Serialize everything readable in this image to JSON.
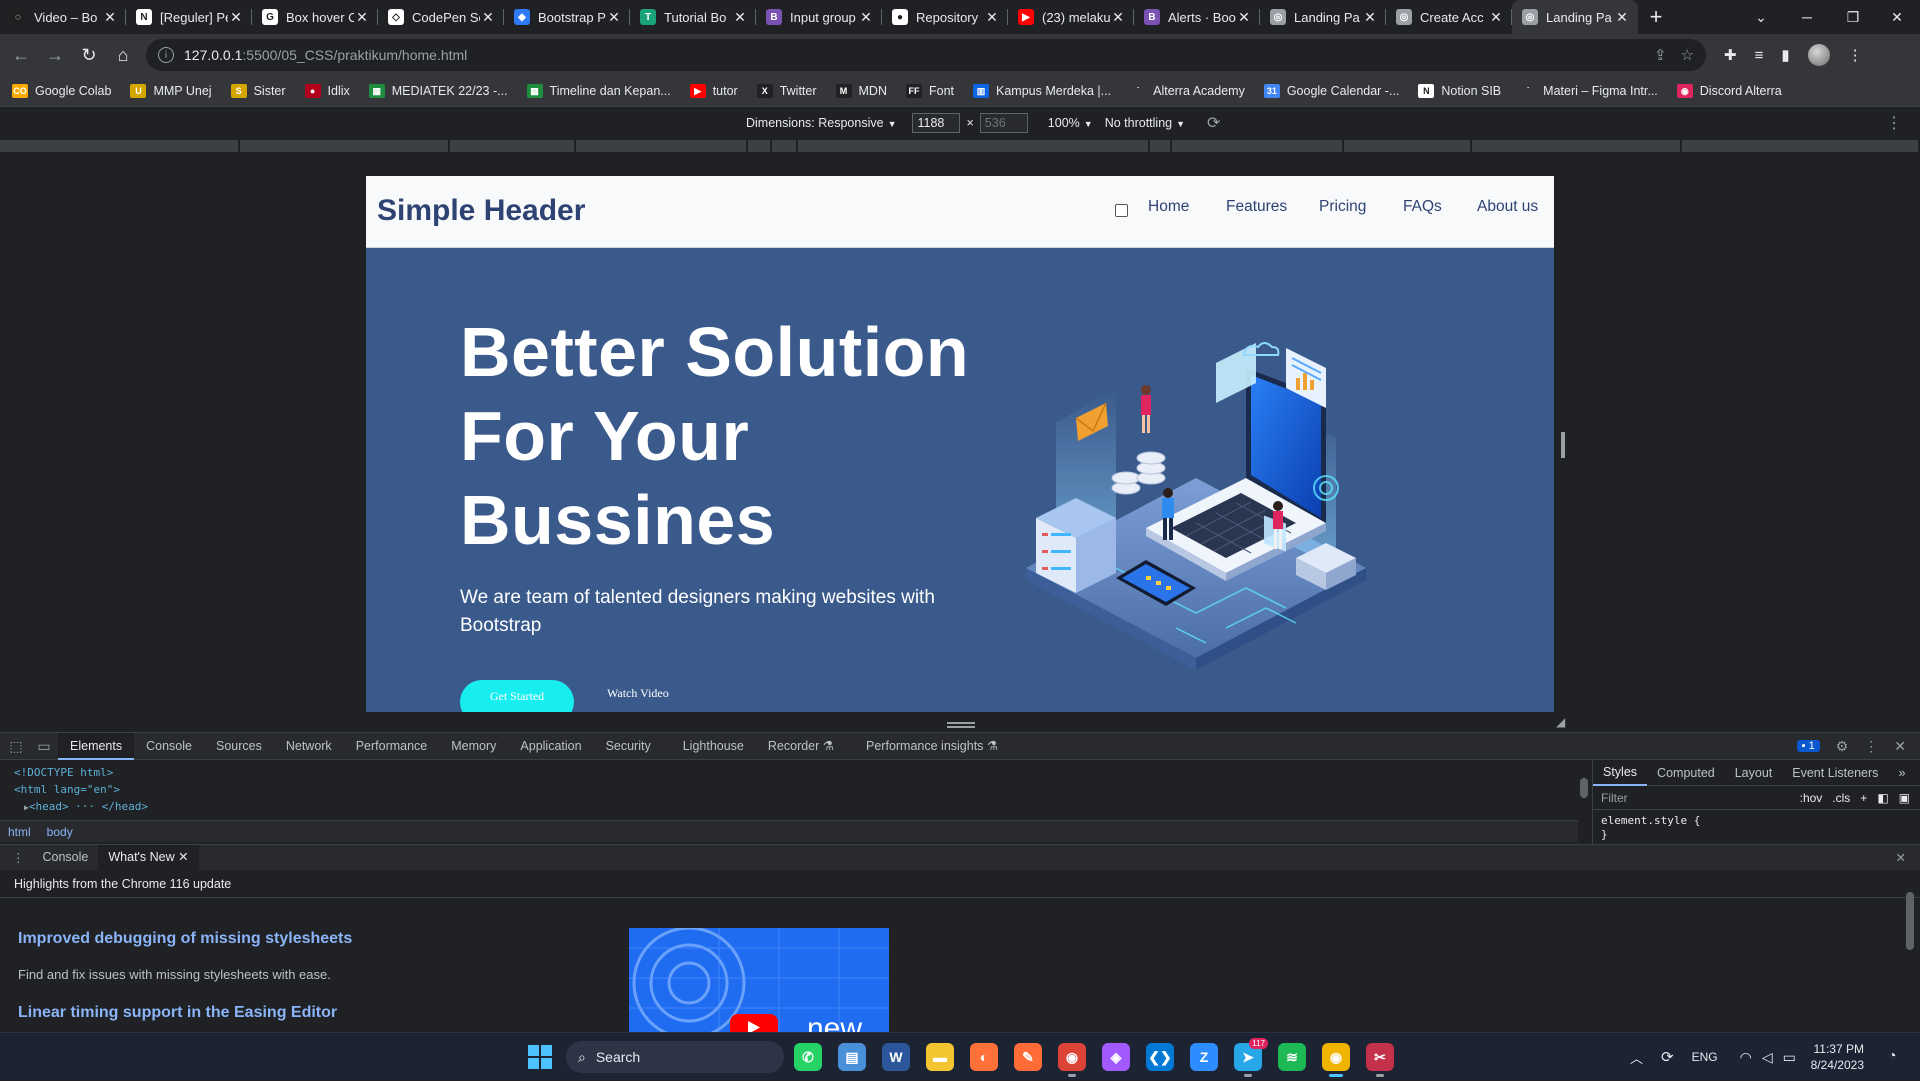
{
  "browser": {
    "tabs": [
      {
        "label": "Video – Bo",
        "icon": "webflow-icon",
        "color": "#1f1f1f",
        "glyph": "◌"
      },
      {
        "label": "[Reguler] Pe",
        "icon": "notion-icon",
        "color": "#ffffff",
        "glyph": "N"
      },
      {
        "label": "Box hover C",
        "icon": "google-icon",
        "color": "#ffffff",
        "glyph": "G"
      },
      {
        "label": "CodePen Se",
        "icon": "codepen-icon",
        "color": "#ffffff",
        "glyph": "◇"
      },
      {
        "label": "Bootstrap P",
        "icon": "bootstrap-icon",
        "color": "#2f7bf6",
        "glyph": "◆"
      },
      {
        "label": "Tutorial Bo",
        "icon": "tutorial-icon",
        "color": "#1aa37a",
        "glyph": "T"
      },
      {
        "label": "Input group",
        "icon": "bootstrap-b-icon",
        "color": "#7952b3",
        "glyph": "B"
      },
      {
        "label": "Repository",
        "icon": "github-icon",
        "color": "#ffffff",
        "glyph": "●"
      },
      {
        "label": "(23) melaku",
        "icon": "youtube-icon",
        "color": "#ff0000",
        "glyph": "▶"
      },
      {
        "label": "Alerts · Boo",
        "icon": "bootstrap-b-icon",
        "color": "#7952b3",
        "glyph": "B"
      },
      {
        "label": "Landing Pa",
        "icon": "globe-icon",
        "color": "#9aa0a6",
        "glyph": "◎"
      },
      {
        "label": "Create Acc",
        "icon": "globe-icon",
        "color": "#9aa0a6",
        "glyph": "◎"
      },
      {
        "label": "Landing Pa",
        "icon": "globe-icon",
        "color": "#9aa0a6",
        "glyph": "◎"
      }
    ],
    "url_host": "127.0.0.1",
    "url_path": ":5500/05_CSS/praktikum/home.html",
    "bookmarks": [
      {
        "label": "Google Colab",
        "icon": "colab-icon",
        "color": "#f9ab00",
        "glyph": "CO"
      },
      {
        "label": "MMP Unej",
        "icon": "unej-icon",
        "color": "#d4a600",
        "glyph": "U"
      },
      {
        "label": "Sister",
        "icon": "sister-icon",
        "color": "#d4a600",
        "glyph": "S"
      },
      {
        "label": "Idlix",
        "icon": "idlix-icon",
        "color": "#b3001b",
        "glyph": "●"
      },
      {
        "label": "MEDIATEK 22/23 -...",
        "icon": "sheets-icon",
        "color": "#1e8e3e",
        "glyph": "▦"
      },
      {
        "label": "Timeline dan Kepan...",
        "icon": "sheets-icon",
        "color": "#1e8e3e",
        "glyph": "▦"
      },
      {
        "label": "tutor",
        "icon": "youtube-icon",
        "color": "#ff0000",
        "glyph": "▶"
      },
      {
        "label": "Twitter",
        "icon": "x-icon",
        "color": "#202124",
        "glyph": "X"
      },
      {
        "label": "MDN",
        "icon": "mdn-icon",
        "color": "#202124",
        "glyph": "M"
      },
      {
        "label": "Font",
        "icon": "font-icon",
        "color": "#202124",
        "glyph": "FF"
      },
      {
        "label": "Kampus Merdeka |...",
        "icon": "trello-icon",
        "color": "#0c66e4",
        "glyph": "▥"
      },
      {
        "label": "Alterra Academy",
        "icon": "alterra-icon",
        "color": "#35363a",
        "glyph": "˙"
      },
      {
        "label": "Google Calendar -...",
        "icon": "calendar-icon",
        "color": "#4285f4",
        "glyph": "31"
      },
      {
        "label": "Notion SIB",
        "icon": "notion-icon",
        "color": "#ffffff",
        "glyph": "N"
      },
      {
        "label": "Materi – Figma Intr...",
        "icon": "alterra-icon",
        "color": "#35363a",
        "glyph": "˙"
      },
      {
        "label": "Discord Alterra",
        "icon": "discord-icon",
        "color": "#e0245e",
        "glyph": "◉"
      }
    ]
  },
  "device_toolbar": {
    "dimensions_label": "Dimensions: Responsive",
    "width": "1188",
    "height": "536",
    "zoom": "100%",
    "throttling": "No throttling"
  },
  "site": {
    "brand": "Simple Header",
    "nav": [
      "Home",
      "Features",
      "Pricing",
      "FAQs",
      "About us"
    ],
    "hero_title": "Better Solution For Your Bussines",
    "hero_subtitle": "We are team of talented designers making websites with Bootstrap",
    "cta_primary": "Get Started",
    "cta_secondary": "Watch Video",
    "colors": {
      "brand": "#2e4374",
      "hero_bg": "#3a5a8c",
      "cta": "#18eef0"
    }
  },
  "devtools": {
    "tabs": [
      "Elements",
      "Console",
      "Sources",
      "Network",
      "Performance",
      "Memory",
      "Application",
      "Security",
      "Lighthouse",
      "Recorder",
      "Performance insights"
    ],
    "issues_count": "1",
    "dom_lines": [
      {
        "text": "<!DOCTYPE html>"
      },
      {
        "text": "<html lang=\"en\">"
      },
      {
        "text": "<head> ··· </head>"
      }
    ],
    "breadcrumbs": [
      "html",
      "body"
    ],
    "styles_tabs": [
      "Styles",
      "Computed",
      "Layout",
      "Event Listeners"
    ],
    "filter_placeholder": "Filter",
    "hov_label": ":hov",
    "cls_label": ".cls",
    "element_style": "element.style {",
    "element_style_close": "}",
    "drawer_tabs": [
      "Console",
      "What's New"
    ],
    "whats_new_header": "Highlights from the Chrome 116 update",
    "whats_new_items": [
      {
        "title": "Improved debugging of missing stylesheets",
        "desc": "Find and fix issues with missing stylesheets with ease."
      },
      {
        "title": "Linear timing support in the Easing Editor"
      }
    ],
    "promo_text": "new"
  },
  "taskbar": {
    "search_label": "Search",
    "apps": [
      {
        "name": "whatsapp-icon",
        "color": "#25d366",
        "glyph": "✆"
      },
      {
        "name": "notepad-icon",
        "color": "#4a90d9",
        "glyph": "▤"
      },
      {
        "name": "word-icon",
        "color": "#2b579a",
        "glyph": "W"
      },
      {
        "name": "file-explorer-icon",
        "color": "#f3c531",
        "glyph": "▬"
      },
      {
        "name": "firefox-icon",
        "color": "#ff7139",
        "glyph": "◐"
      },
      {
        "name": "postman-icon",
        "color": "#ff6c37",
        "glyph": "✎"
      },
      {
        "name": "chrome-icon",
        "color": "#db4437",
        "glyph": "◉"
      },
      {
        "name": "figma-icon",
        "color": "#a259ff",
        "glyph": "◈"
      },
      {
        "name": "vscode-icon",
        "color": "#0078d4",
        "glyph": "❮❯"
      },
      {
        "name": "zoom-icon",
        "color": "#2d8cff",
        "glyph": "Z"
      },
      {
        "name": "telegram-icon",
        "color": "#27a7e7",
        "glyph": "➤"
      },
      {
        "name": "spotify-icon",
        "color": "#1db954",
        "glyph": "≋"
      },
      {
        "name": "chrome-canary-icon",
        "color": "#f0b400",
        "glyph": "◉"
      },
      {
        "name": "snipping-tool-icon",
        "color": "#c4314b",
        "glyph": "✂"
      }
    ],
    "telegram_badge": "117",
    "language": "ENG",
    "time": "11:37 PM",
    "date": "8/24/2023"
  }
}
